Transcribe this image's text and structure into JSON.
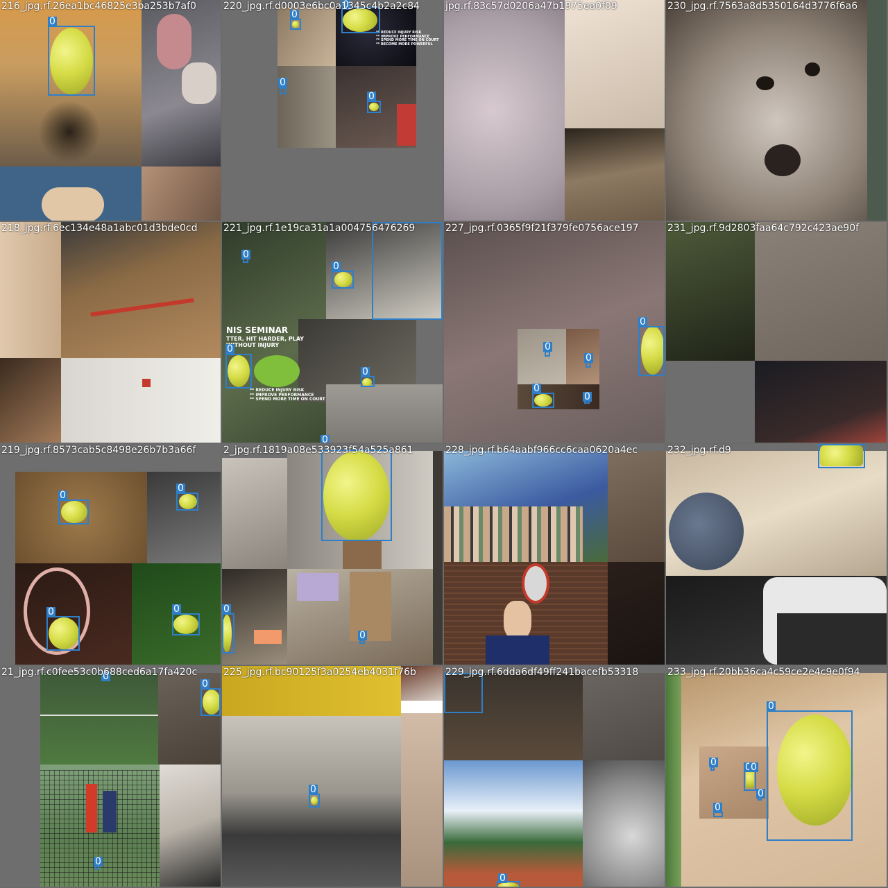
{
  "labels": {
    "0": "216_jpg.rf.26ea1bc46825e3ba253b7af0",
    "1": "220_jpg.rf.d0003e6bc0a1345c4b2a2c84",
    "2": "jpg.rf.83c57d0206a47b1975ea0f09",
    "3": "230_jpg.rf.7563a8d5350164d3776f6a6",
    "4": "218_jpg.rf.6ec134e48a1abc01d3bde0cd",
    "5": "221_jpg.rf.1e19ca31a1a004756476269",
    "6": "227_jpg.rf.0365f9f21f379fe0756ace197",
    "7": "231_jpg.rf.9d2803faa64c792c423ae90f",
    "8": "219_jpg.rf.8573cab5c8498e26b7b3a66f",
    "9": "2_jpg.rf.1819a08e533923f54a525a861",
    "10": "228_jpg.rf.b64aabf966cc6caa0620a4ec",
    "11": "232_jpg.rf.d9",
    "12": "21_jpg.rf.c0fee53c0b688ced6a17fa420c",
    "13": "225_jpg.rf.bc90125f3a0254eb4031f76b",
    "14": "229_jpg.rf.6dda6df49ff241bacefb53318",
    "15": "233_jpg.rf.20bb36ca4c59ce2e4c9e0f94"
  },
  "box_class": "0",
  "poster_texts": {
    "p1": "** REDUCE INJURY RISK\n** IMPROVE PERFORMANCE\n** SPEND MORE TIME ON COURT\n** BECOME MORE POWERFUL",
    "p2": "NIS SEMINAR",
    "p3": "TTER, HIT HARDER, PLAY\nWITHOUT INJURY",
    "p4": "** REDUCE INJURY RISK\n** IMPROVE PERFORMANCE\n** SPEND MORE TIME ON COURT"
  },
  "colors": {
    "box": "#2f7fc8",
    "mosaic_gray": "#6e6e6e"
  }
}
